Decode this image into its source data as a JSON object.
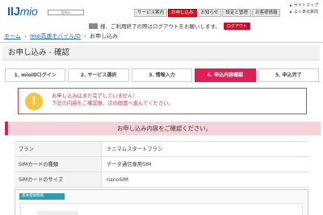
{
  "brand": {
    "logo_prefix": "IIJ",
    "logo_suffix": "mio",
    "sub": "IIJmio"
  },
  "nav": {
    "tabs": [
      "サービス案内",
      "お申し込み",
      "お知らせ",
      "設定と管理",
      "お客様情報"
    ],
    "active_index": 1
  },
  "side_links": [
    "サイトマップ",
    "よくある質問"
  ],
  "notice": {
    "text": "様、ご利用終了の際はログアウトをお願いします。",
    "logout_label": "ログアウト"
  },
  "breadcrumb": [
    "ホーム",
    "mio高速モバイル/D",
    "お申し込み"
  ],
  "page_title": "お申し込み - 確認",
  "steps": [
    "1. mioIDログイン",
    "2. サービス選択",
    "3. 情報入力",
    "4. 申込内容確認",
    "5. 申込完了"
  ],
  "current_step_index": 3,
  "alert": {
    "line1": "お申し込みはまだ完了していません！",
    "line2": "下記の内容をご確認後、次の画面へ進んでください。"
  },
  "banner": "お申し込み内容をご確認ください。",
  "details": {
    "rows": [
      {
        "label": "プラン",
        "value": "ミニマムスタートプラン"
      },
      {
        "label": "SIMカードの種類",
        "value": "データ通信専用SIM"
      },
      {
        "label": "SIMカードのサイズ",
        "value": "nanoSIM"
      }
    ]
  },
  "section": {
    "title": "基本登録情報"
  },
  "colors": {
    "brand_blue": "#1d63b8",
    "accent_pink": "#e01e5a",
    "alert_red": "#e0304a",
    "section_teal": "#2a9fb2"
  }
}
